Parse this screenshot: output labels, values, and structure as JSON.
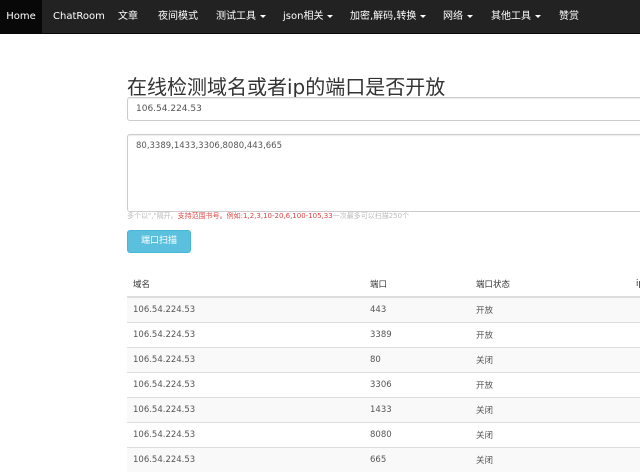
{
  "navbar": {
    "items": [
      {
        "label": "Home",
        "dropdown": false
      },
      {
        "label": "ChatRoom",
        "dropdown": false
      },
      {
        "label": "文章",
        "dropdown": false
      },
      {
        "label": "夜间模式",
        "dropdown": false
      },
      {
        "label": "测试工具",
        "dropdown": true
      },
      {
        "label": "json相关",
        "dropdown": true
      },
      {
        "label": "加密,解码,转换",
        "dropdown": true
      },
      {
        "label": "网络",
        "dropdown": true
      },
      {
        "label": "其他工具",
        "dropdown": true
      },
      {
        "label": "赞赏",
        "dropdown": false
      }
    ]
  },
  "page": {
    "title": "在线检测域名或者ip的端口是否开放"
  },
  "form": {
    "host_value": "106.54.224.53",
    "ports_value": "80,3389,1433,3306,8080,443,665",
    "help_prefix": "多个以\",\"隔开。",
    "help_highlight": "支持范围书号。例如:1,2,3,10-20,6,100-105,33",
    "help_suffix": "一次最多可以扫描250个",
    "scan_label": "端口扫描"
  },
  "table": {
    "headers": [
      "域名",
      "端口",
      "端口状态",
      "ip"
    ],
    "rows": [
      {
        "host": "106.54.224.53",
        "port": "443",
        "status": "开放",
        "open": true
      },
      {
        "host": "106.54.224.53",
        "port": "3389",
        "status": "开放",
        "open": true
      },
      {
        "host": "106.54.224.53",
        "port": "80",
        "status": "关闭",
        "open": false
      },
      {
        "host": "106.54.224.53",
        "port": "3306",
        "status": "开放",
        "open": true
      },
      {
        "host": "106.54.224.53",
        "port": "1433",
        "status": "关闭",
        "open": false
      },
      {
        "host": "106.54.224.53",
        "port": "8080",
        "status": "关闭",
        "open": false
      },
      {
        "host": "106.54.224.53",
        "port": "665",
        "status": "关闭",
        "open": false
      }
    ]
  },
  "colors": {
    "navbar_bg": "#222222",
    "accent": "#5bc0de",
    "open_status": "#e0403a"
  }
}
